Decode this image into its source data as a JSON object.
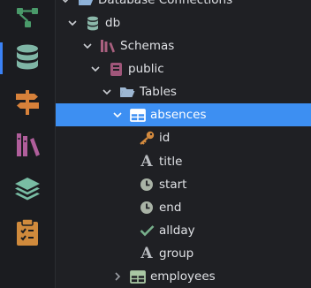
{
  "activity_bar": {
    "items": [
      {
        "name": "git-graph-icon",
        "color": "#4a9a6a"
      },
      {
        "name": "database-icon",
        "color": "#7fb6a6",
        "active": true
      },
      {
        "name": "signpost-icon",
        "color": "#d7813a"
      },
      {
        "name": "library-icon",
        "color": "#b05e9b"
      },
      {
        "name": "layers-icon",
        "color": "#79bda4"
      },
      {
        "name": "clipboard-icon",
        "color": "#d08a3c"
      }
    ],
    "accent": "#3b82f6"
  },
  "tree": {
    "root_label": "Database Connections",
    "db_label": "db",
    "schemas_label": "Schemas",
    "public_label": "public",
    "tables_label": "Tables",
    "absences_label": "absences",
    "columns": [
      {
        "label": "id",
        "icon": "key-icon"
      },
      {
        "label": "title",
        "icon": "text-type-icon"
      },
      {
        "label": "start",
        "icon": "clock-icon"
      },
      {
        "label": "end",
        "icon": "clock-icon"
      },
      {
        "label": "allday",
        "icon": "check-icon"
      },
      {
        "label": "group",
        "icon": "text-type-icon"
      }
    ],
    "employees_label": "employees",
    "selected_color": "#3d8ff2"
  }
}
